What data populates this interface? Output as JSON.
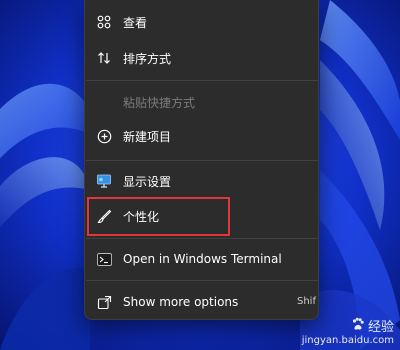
{
  "context_menu": {
    "items": [
      {
        "label": "查看",
        "icon": "grid-view-icon"
      },
      {
        "label": "排序方式",
        "icon": "sort-arrows-icon"
      },
      {
        "label": "粘贴快捷方式",
        "icon": "none"
      },
      {
        "label": "新建项目",
        "icon": "plus-circle-icon"
      },
      {
        "label": "显示设置",
        "icon": "monitor-icon"
      },
      {
        "label": "个性化",
        "icon": "brush-icon"
      },
      {
        "label": "Open in Windows Terminal",
        "icon": "terminal-icon"
      },
      {
        "label": "Show more options",
        "icon": "expand-icon"
      }
    ],
    "shortcut": "Shif",
    "highlight_color": "#e0353a"
  },
  "watermark": {
    "brand": "经验",
    "url": "jingyan.baidu.com"
  }
}
